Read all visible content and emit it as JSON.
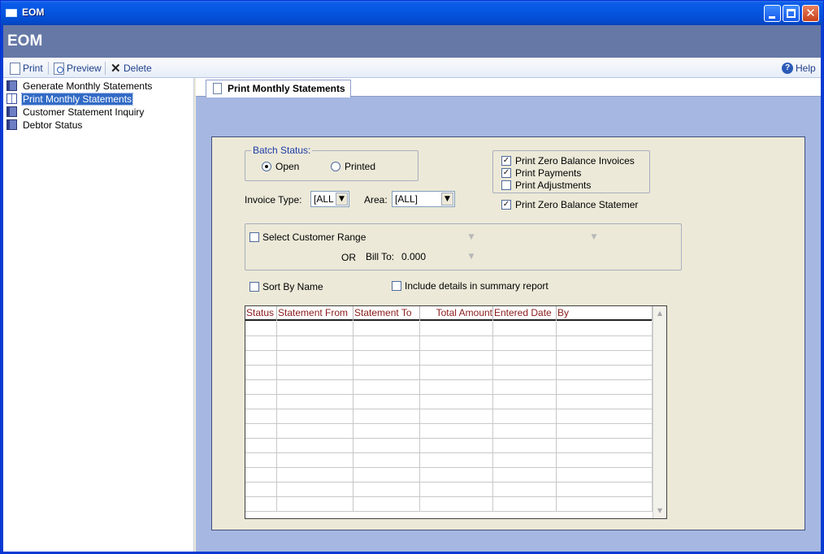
{
  "window": {
    "title": "EOM"
  },
  "header": {
    "title": "EOM"
  },
  "toolbar": {
    "print": "Print",
    "preview": "Preview",
    "delete": "Delete",
    "help": "Help"
  },
  "sidebar": {
    "items": [
      {
        "label": "Generate Monthly Statements"
      },
      {
        "label": "Print Monthly Statements"
      },
      {
        "label": "Customer Statement Inquiry"
      },
      {
        "label": "Debtor Status"
      }
    ]
  },
  "tab": {
    "label": "Print Monthly Statements"
  },
  "form": {
    "batch_status": {
      "title": "Batch Status:",
      "open": "Open",
      "printed": "Printed",
      "selected": "Open"
    },
    "options": {
      "zero_invoices": "Print Zero Balance Invoices",
      "payments": "Print Payments",
      "adjustments": "Print Adjustments",
      "zero_statements": "Print Zero Balance Statemer"
    },
    "invoice_type": {
      "label": "Invoice Type:",
      "value": "[ALL"
    },
    "area": {
      "label": "Area:",
      "value": "[ALL]"
    },
    "customer_range": {
      "label": "Select Customer Range",
      "or": "OR",
      "bill_to_label": "Bill To:",
      "bill_to_value": "0.000"
    },
    "sort_by_name": "Sort By Name",
    "include_details": "Include details in summary report"
  },
  "grid": {
    "columns": [
      "Status",
      "Statement From",
      "Statement To",
      "Total Amount",
      "Entered Date",
      "By"
    ],
    "rows": 13
  },
  "colors": {
    "header_band": "#6678A6",
    "content_bg": "#A6B7E2",
    "grid_header_text": "#8B1B1B"
  },
  "icons": [
    "window-icon",
    "page-icon",
    "preview-icon",
    "delete-icon",
    "help-icon",
    "book-icon",
    "open-book-icon"
  ]
}
